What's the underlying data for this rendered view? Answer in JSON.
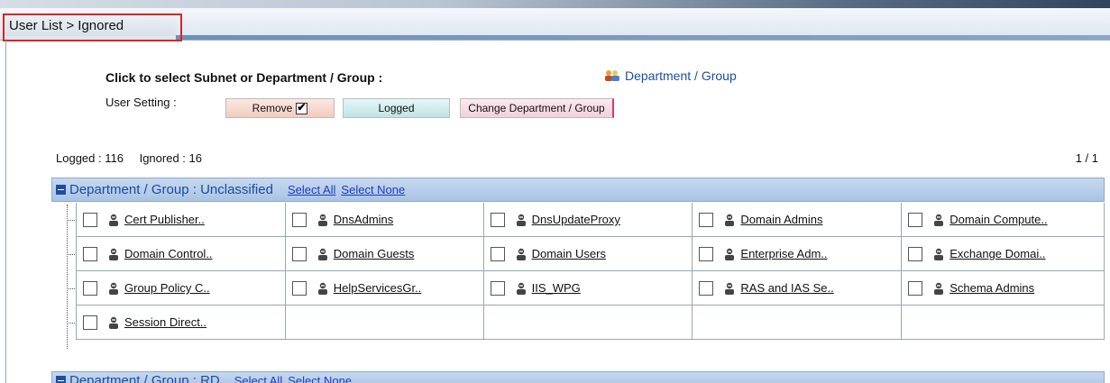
{
  "breadcrumb": "User List > Ignored",
  "select_label": "Click to select Subnet or Department / Group :",
  "dept_link": "Department / Group",
  "user_setting_label": "User Setting :",
  "buttons": {
    "remove": "Remove",
    "logged": "Logged",
    "change": "Change Department / Group"
  },
  "stats": {
    "logged": "Logged : 116",
    "ignored": "Ignored : 16",
    "pager": "1 / 1"
  },
  "group1": {
    "title": "Department / Group : Unclassified",
    "select_all": "Select All",
    "select_none": "Select None"
  },
  "group2": {
    "title": "Department / Group : RD",
    "select_all": "Select All",
    "select_none": "Select None"
  },
  "users": [
    [
      "Cert Publisher..",
      "DnsAdmins",
      "DnsUpdateProxy",
      "Domain Admins",
      "Domain Compute.."
    ],
    [
      "Domain Control..",
      "Domain Guests",
      "Domain Users",
      "Enterprise Adm..",
      "Exchange Domai.."
    ],
    [
      "Group Policy C..",
      "HelpServicesGr..",
      "IIS_WPG",
      "RAS and IAS Se..",
      "Schema Admins"
    ],
    [
      "Session Direct..",
      "",
      "",
      "",
      ""
    ]
  ],
  "icons": {
    "user": "user-icon",
    "group": "group-icon",
    "collapse": "minus-icon"
  },
  "colors": {
    "accent_red": "#d9232a",
    "link": "#1d3fb8",
    "group_header": "#a9c3e5"
  }
}
